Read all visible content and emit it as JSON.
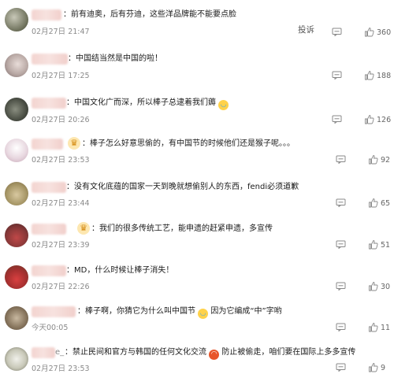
{
  "comments": [
    {
      "text": "：前有迪奥，后有芬迪，这些洋品牌能不能要点脸",
      "time": "02月27日 21:47",
      "likes": "360",
      "report": "投诉"
    },
    {
      "text": "：中国结当然是中国的啦！",
      "time": "02月27日 17:25",
      "likes": "188"
    },
    {
      "text": "：中国文化广而深，所以棒子总逮着我们薅",
      "time": "02月27日 20:26",
      "likes": "126"
    },
    {
      "text": "：棒子怎么好意思偷的，有中国节的时候他们还是猴子呢。。。",
      "time": "02月27日 23:53",
      "likes": "92"
    },
    {
      "text": "：没有文化底蕴的国家一天到晚就想偷别人的东西，fendi必须道歉",
      "time": "02月27日 23:44",
      "likes": "65"
    },
    {
      "text": "：我们的很多传统工艺，能申遗的赶紧申遗，多宣传",
      "time": "02月27日 23:39",
      "likes": "51"
    },
    {
      "text": "：MD，什么时候让棒子消失！",
      "time": "02月27日 22:26",
      "likes": "30"
    },
    {
      "text_a": "：棒子啊，你猜它为什么叫中国节",
      "text_b": "因为它编成“中”字哟",
      "time": "今天00:05",
      "likes": "11"
    },
    {
      "name_tail": "e_",
      "text_a": "：禁止民间和官方与韩国的任何文化交流",
      "text_b": "防止被偷走，咱们要在国际上多多宣传",
      "time": "02月27日 23:53",
      "likes": "9"
    }
  ],
  "icons": {
    "reply": "comment-reply-icon",
    "like": "thumbs-up-icon",
    "vip": "crown-badge-icon"
  },
  "colors": {
    "text": "#1a1a1a",
    "meta": "#8a8a8a",
    "blur_name": "#f3d4d0"
  }
}
